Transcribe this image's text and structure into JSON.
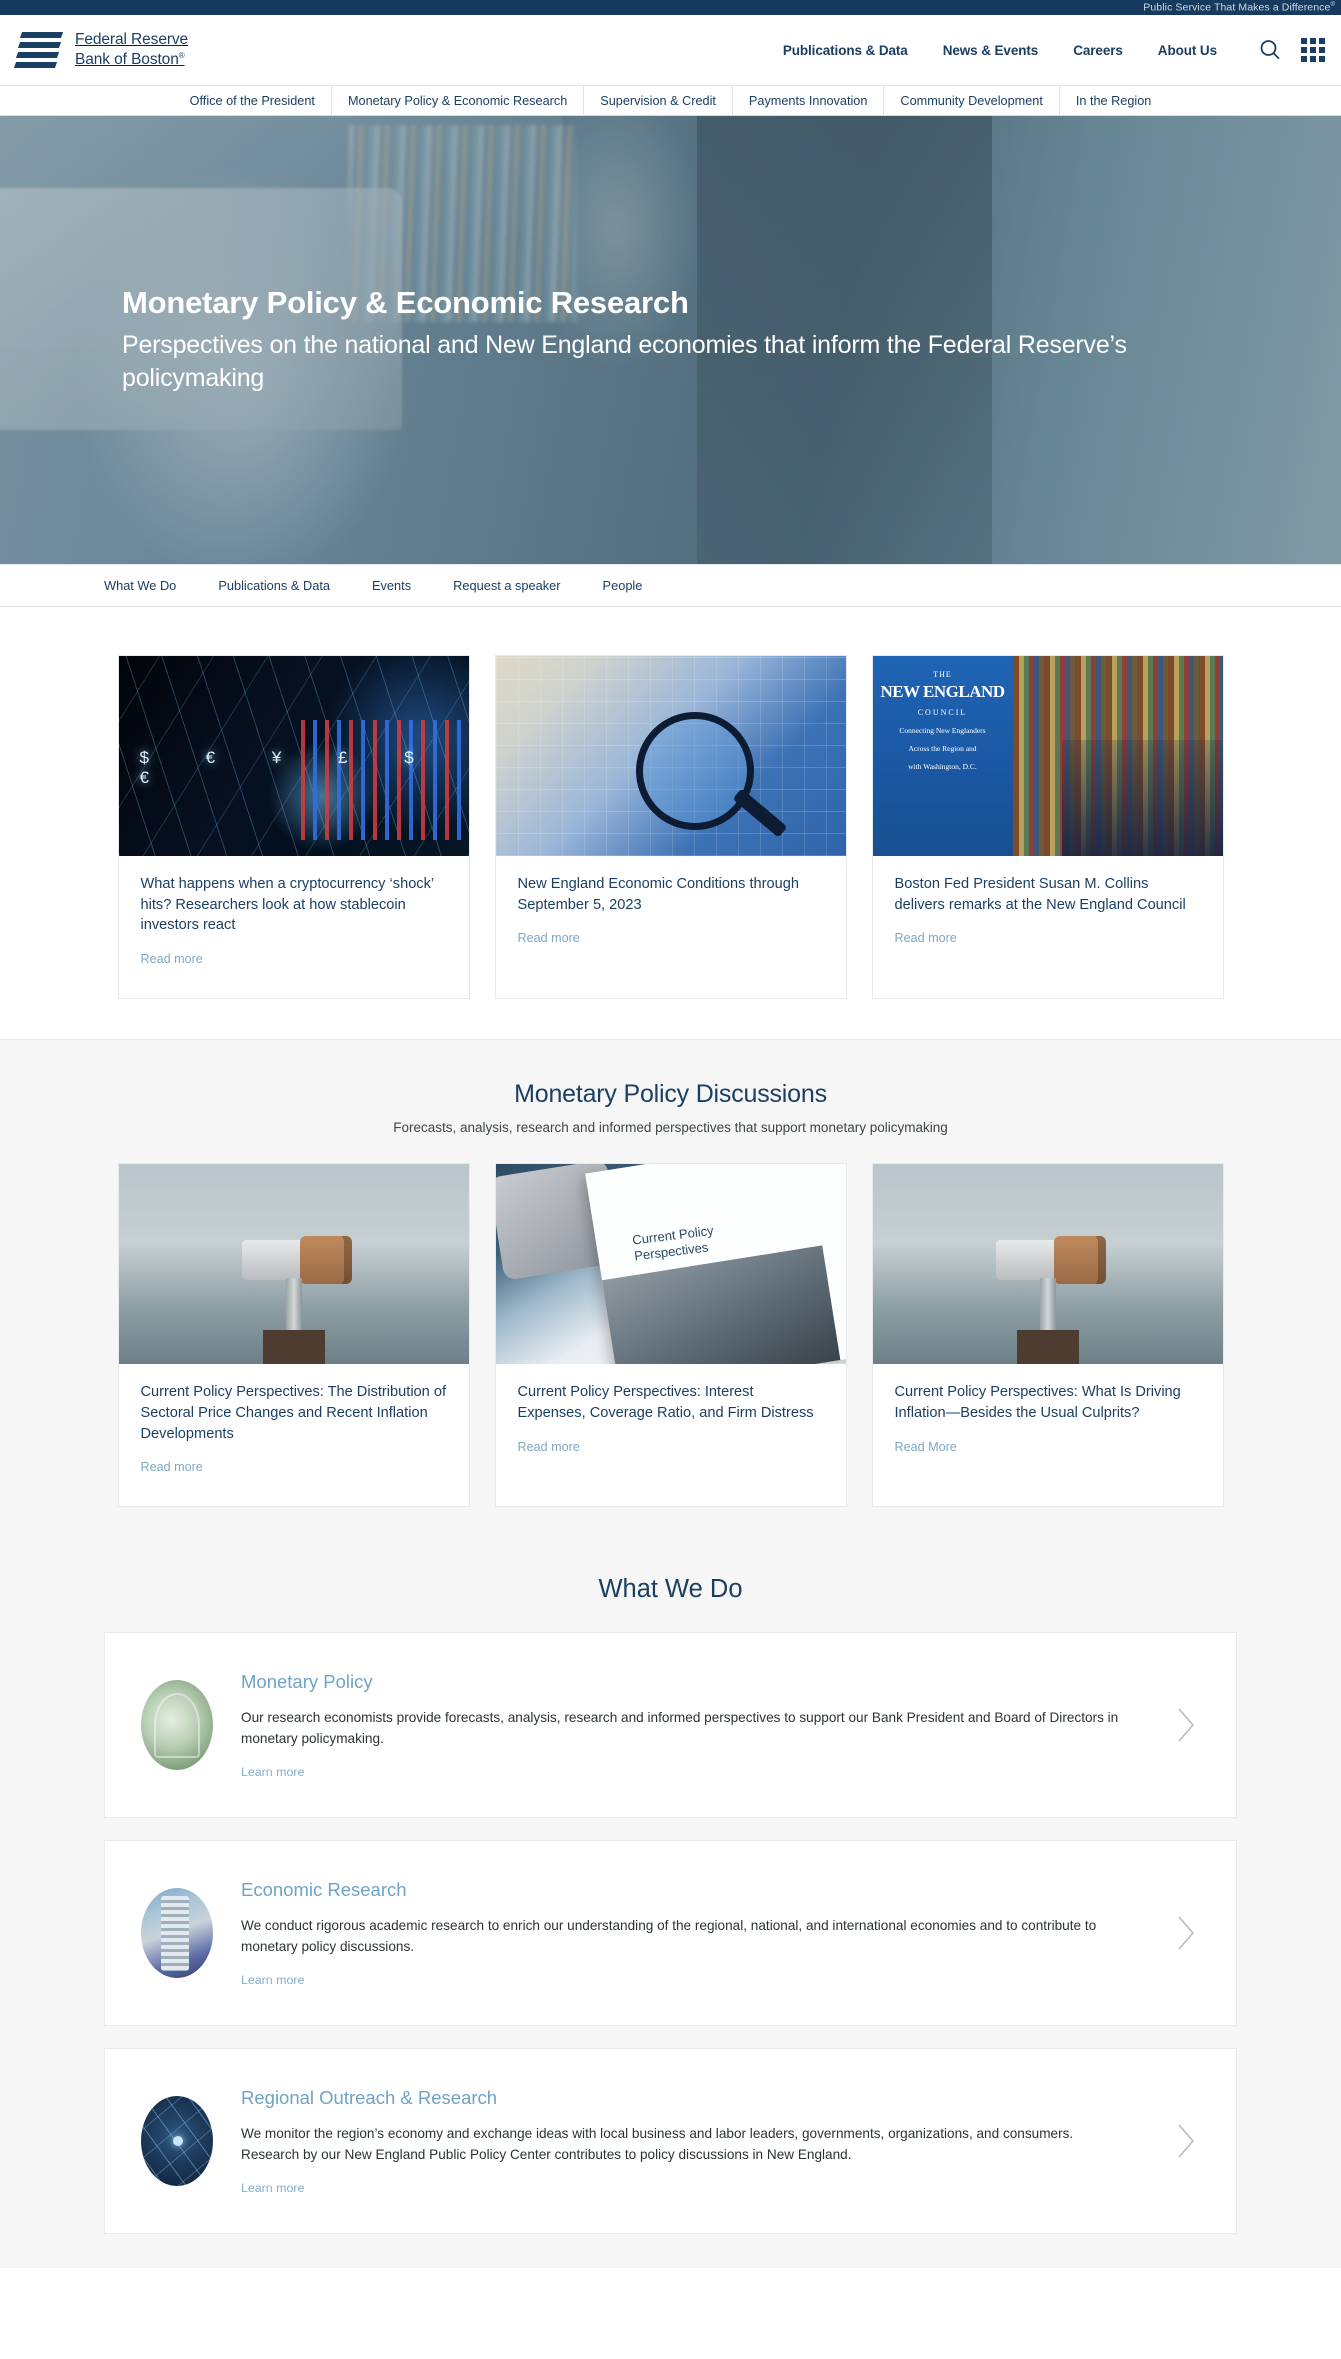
{
  "utility": {
    "tagline": "Public Service That Makes a Difference",
    "registered_mark": "®"
  },
  "brand": {
    "line1": "Federal Reserve",
    "line2": "Bank of Boston",
    "registered_mark": "®",
    "logo_icon": "fed-reserve-bars-logo"
  },
  "header": {
    "nav": [
      {
        "label": "Publications & Data"
      },
      {
        "label": "News & Events"
      },
      {
        "label": "Careers"
      },
      {
        "label": "About Us"
      }
    ],
    "icons": [
      {
        "name": "search-icon"
      },
      {
        "name": "app-grid-icon"
      }
    ]
  },
  "section_nav": [
    {
      "label": "Office of the President"
    },
    {
      "label": "Monetary Policy & Economic Research"
    },
    {
      "label": "Supervision & Credit"
    },
    {
      "label": "Payments Innovation"
    },
    {
      "label": "Community Development"
    },
    {
      "label": "In the Region"
    }
  ],
  "hero": {
    "title": "Monetary Policy & Economic Research",
    "subtitle": "Perspectives on the national and New England economies that inform the Federal Reserve’s policymaking",
    "image_description": "man in suit working on a laptop in a library"
  },
  "page_nav": [
    {
      "label": "What We Do"
    },
    {
      "label": "Publications & Data"
    },
    {
      "label": "Events"
    },
    {
      "label": "Request a speaker"
    },
    {
      "label": "People"
    }
  ],
  "featured_cards": [
    {
      "title": "What happens when a cryptocurrency ‘shock’ hits? Researchers look at how stablecoin investors react",
      "link_label": "Read more",
      "image_description": "dark financial network with currency symbols and candlestick chart"
    },
    {
      "title": "New England Economic Conditions through September 5, 2023",
      "link_label": "Read more",
      "image_description": "magnifying glass over a map of New England with blue bar charts"
    },
    {
      "title": "Boston Fed President Susan M. Collins delivers remarks at the New England Council",
      "link_label": "Read more",
      "image_description": "two people seated in front of a New England Council banner and bookshelves"
    }
  ],
  "discussions": {
    "title": "Monetary Policy Discussions",
    "subtitle": "Forecasts, analysis, research and informed perspectives that support monetary policymaking",
    "cards": [
      {
        "title": "Current Policy Perspectives: The Distribution of Sectoral Price Changes and Recent Inflation Developments",
        "link_label": "Read more",
        "image_description": "coin-operated viewer binoculars against a cloudy sky"
      },
      {
        "title": "Current Policy Perspectives: Interest Expenses, Coverage Ratio, and Firm Distress",
        "link_label": "Read more",
        "image_description": "Current Policy Perspectives report cover beside a smartphone"
      },
      {
        "title": "Current Policy Perspectives: What Is Driving Inflation—Besides the Usual Culprits?",
        "link_label": "Read More",
        "image_description": "coin-operated viewer binoculars against a cloudy sky"
      }
    ]
  },
  "what_we_do": {
    "title": "What We Do",
    "items": [
      {
        "heading": "Monetary Policy",
        "description": "Our research economists provide forecasts, analysis, research and informed perspectives to support our Bank President and Board of Directors in monetary policymaking.",
        "link_label": "Learn more",
        "thumb_description": "close-up of currency engraving"
      },
      {
        "heading": "Economic Research",
        "description": "We conduct rigorous academic research to enrich our understanding of the regional, national, and international economies and to contribute to monetary policy discussions.",
        "link_label": "Learn more",
        "thumb_description": "stacks of coins over a globe"
      },
      {
        "heading": "Regional Outreach & Research",
        "description": "We monitor the region’s economy and exchange ideas with local business and labor leaders, governments, organizations, and consumers. Research by our New England Public Policy Center contributes to policy discussions in New England.",
        "link_label": "Learn more",
        "thumb_description": "network of connected people nodes"
      }
    ]
  },
  "colors": {
    "brand_navy": "#1b3f63",
    "utility_bar": "#173b5e",
    "link_blue": "#7fa8c4",
    "heading_blue": "#6ea3c6",
    "band_background": "#f6f6f6"
  }
}
